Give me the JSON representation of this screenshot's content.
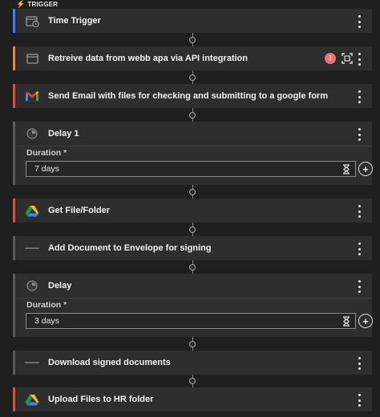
{
  "trigger_label": "TRIGGER",
  "colors": {
    "blue": "#3b82f6",
    "orange": "#e8814a",
    "red": "#d94d4d",
    "gray": "#5a5a5a",
    "error": "#f07070"
  },
  "steps": [
    {
      "title": "Time Trigger",
      "icon": "calendar-clock-icon",
      "accent": "blue"
    },
    {
      "title": "Retreive data from webb apa via API integration",
      "icon": "browser-window-icon",
      "accent": "orange",
      "error": "!"
    },
    {
      "title": "Send Email with files for checking and submitting to a google form",
      "icon": "gmail-icon",
      "accent": "red"
    },
    {
      "title": "Delay 1",
      "icon": "clock-icon",
      "accent": "gray",
      "duration_label": "Duration *",
      "duration_value": "7 days"
    },
    {
      "title": "Get File/Folder",
      "icon": "google-drive-icon",
      "accent": "red"
    },
    {
      "title": "Add Document to Envelope for signing",
      "icon": "docusign-logo-icon",
      "accent": "gray"
    },
    {
      "title": "Delay",
      "icon": "clock-icon",
      "accent": "gray",
      "duration_label": "Duration *",
      "duration_value": "3 days"
    },
    {
      "title": "Download signed documents",
      "icon": "docusign-logo-icon",
      "accent": "gray"
    },
    {
      "title": "Upload Files to HR folder",
      "icon": "google-drive-icon",
      "accent": "red"
    }
  ]
}
